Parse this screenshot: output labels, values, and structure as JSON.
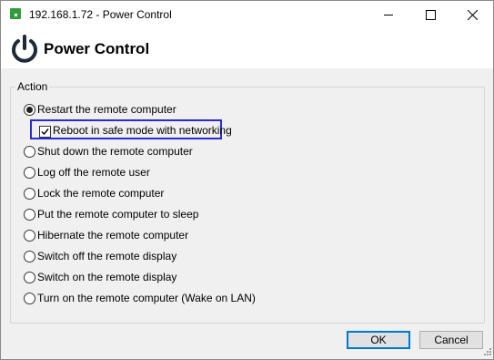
{
  "window": {
    "title": "192.168.1.72 - Power Control",
    "icons": {
      "app": "remote-desktop-app-icon",
      "minimize": "minimize-icon",
      "maximize": "maximize-icon",
      "close": "close-icon"
    }
  },
  "header": {
    "title": "Power Control",
    "icon": "power-icon",
    "icon_color": "#1f2a36"
  },
  "action_group": {
    "legend": "Action",
    "options": [
      {
        "label": "Restart the remote computer",
        "selected": true
      },
      {
        "label": "Shut down the remote computer",
        "selected": false
      },
      {
        "label": "Log off the remote user",
        "selected": false
      },
      {
        "label": "Lock the remote computer",
        "selected": false
      },
      {
        "label": "Put the remote computer to sleep",
        "selected": false
      },
      {
        "label": "Hibernate the remote computer",
        "selected": false
      },
      {
        "label": "Switch off the remote display",
        "selected": false
      },
      {
        "label": "Switch on the remote display",
        "selected": false
      },
      {
        "label": "Turn on the remote computer (Wake on LAN)",
        "selected": false
      }
    ],
    "safe_mode_checkbox": {
      "label": "Reboot in safe mode with networking",
      "checked": true,
      "highlight_color": "#2a2ad8"
    }
  },
  "buttons": {
    "ok": "OK",
    "cancel": "Cancel",
    "accent_color": "#0078d7"
  }
}
